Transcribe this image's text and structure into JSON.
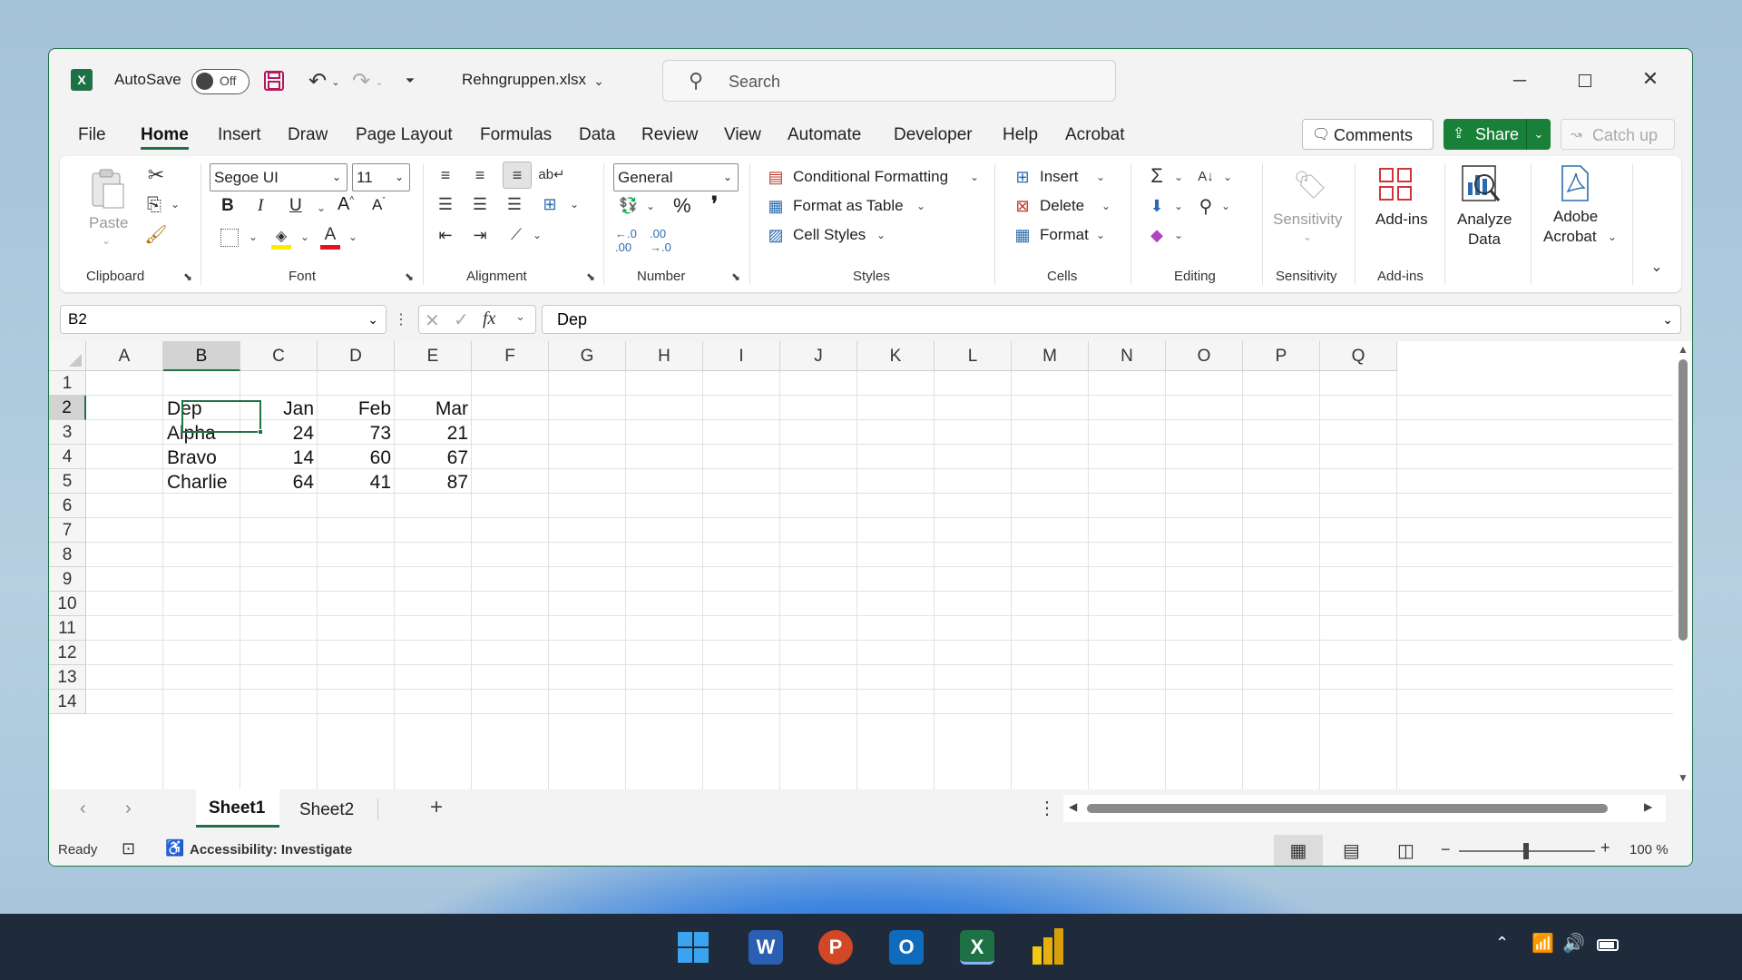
{
  "title_bar": {
    "autosave_label": "AutoSave",
    "autosave_state": "Off",
    "filename": "Rehngruppen.xlsx",
    "search_placeholder": "Search"
  },
  "menu": [
    "File",
    "Home",
    "Insert",
    "Draw",
    "Page Layout",
    "Formulas",
    "Data",
    "Review",
    "View",
    "Automate",
    "Developer",
    "Help",
    "Acrobat"
  ],
  "active_tab": "Home",
  "actions": {
    "comments": "Comments",
    "share": "Share",
    "catch_up": "Catch up"
  },
  "ribbon": {
    "clipboard": {
      "label": "Clipboard",
      "paste": "Paste"
    },
    "font": {
      "label": "Font",
      "family": "Segoe UI",
      "size": "11"
    },
    "alignment": {
      "label": "Alignment"
    },
    "number": {
      "label": "Number",
      "format": "General"
    },
    "styles": {
      "label": "Styles",
      "conditional_formatting": "Conditional Formatting",
      "format_as_table": "Format as Table",
      "cell_styles": "Cell Styles"
    },
    "cells": {
      "label": "Cells",
      "insert": "Insert",
      "delete": "Delete",
      "format": "Format"
    },
    "editing": {
      "label": "Editing"
    },
    "sensitivity": {
      "label": "Sensitivity",
      "button": "Sensitivity"
    },
    "addins": {
      "label": "Add-ins",
      "button": "Add-ins"
    },
    "analyze": {
      "line1": "Analyze",
      "line2": "Data"
    },
    "acrobat": {
      "line1": "Adobe",
      "line2": "Acrobat"
    }
  },
  "formula_bar": {
    "name_box": "B2",
    "fx": "fx",
    "content": "Dep"
  },
  "sheet": {
    "columns": [
      "A",
      "B",
      "C",
      "D",
      "E",
      "F",
      "G",
      "H",
      "I",
      "J",
      "K",
      "L",
      "M",
      "N",
      "O",
      "P",
      "Q"
    ],
    "rows": [
      "1",
      "2",
      "3",
      "4",
      "5",
      "6",
      "7",
      "8",
      "9",
      "10",
      "11",
      "12",
      "13",
      "14"
    ],
    "selected_cell": "B2",
    "cells": {
      "B2": "Dep",
      "C2": "Jan",
      "D2": "Feb",
      "E2": "Mar",
      "B3": "Alpha",
      "C3": "24",
      "D3": "73",
      "E3": "21",
      "B4": "Bravo",
      "C4": "14",
      "D4": "60",
      "E4": "67",
      "B5": "Charlie",
      "C5": "64",
      "D5": "41",
      "E5": "87"
    }
  },
  "sheet_tabs": [
    "Sheet1",
    "Sheet2"
  ],
  "active_sheet": "Sheet1",
  "status_bar": {
    "ready": "Ready",
    "accessibility": "Accessibility: Investigate",
    "zoom": "100 %"
  },
  "colors": {
    "excel_green": "#1e7145",
    "share_green": "#188038",
    "selection": "#217346"
  }
}
